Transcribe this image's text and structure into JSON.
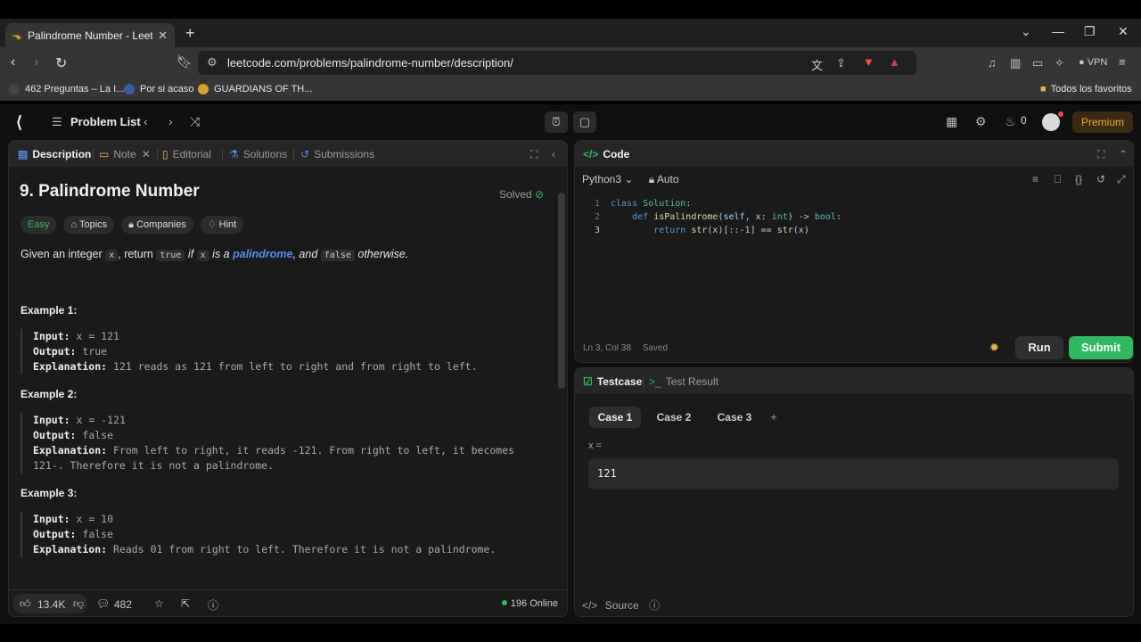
{
  "browser": {
    "tab_title": "Palindrome Number - LeetCode",
    "url": "leetcode.com/problems/palindrome-number/description/",
    "vpn_label": "VPN",
    "bookmarks": [
      {
        "label": "462 Preguntas – La I...",
        "color": "#444444"
      },
      {
        "label": "Por si acaso",
        "color": "#3d5aa8"
      },
      {
        "label": "GUARDIANS OF TH...",
        "color": "#d9a520"
      }
    ],
    "all_favorites": "Todos los favoritos"
  },
  "nav": {
    "problem_list": "Problem List",
    "streak": "0",
    "premium": "Premium"
  },
  "description_panel": {
    "tabs": [
      "Description",
      "Note",
      "Editorial",
      "Solutions",
      "Submissions"
    ],
    "title": "9. Palindrome Number",
    "solved": "Solved",
    "tags": [
      "Easy",
      "Topics",
      "Companies",
      "Hint"
    ],
    "statement": {
      "p1": "Given an integer",
      "x": "x",
      "p2": ", return",
      "true": "true",
      "p3": "if",
      "p4": "is a",
      "palindrome": "palindrome",
      "p5": ", and",
      "false": "false",
      "p6": "otherwise."
    },
    "examples": [
      {
        "title": "Example 1:",
        "input": "x = 121",
        "output": "true",
        "explanation": "121 reads as 121 from left to right and from right to left.",
        "explanation2": ""
      },
      {
        "title": "Example 2:",
        "input": "x = -121",
        "output": "false",
        "explanation": "From left to right, it reads -121. From right to left, it becomes",
        "explanation2": "121-. Therefore it is not a palindrome."
      },
      {
        "title": "Example 3:",
        "input": "x = 10",
        "output": "false",
        "explanation": "Reads 01 from right to left. Therefore it is not a palindrome.",
        "explanation2": ""
      }
    ],
    "labels": {
      "input": "Input:",
      "output": "Output:",
      "explanation": "Explanation:"
    },
    "footer": {
      "likes": "13.4K",
      "comments": "482",
      "online": "196 Online"
    }
  },
  "code_panel": {
    "title": "Code",
    "language": "Python3",
    "auto": "Auto",
    "lines": [
      "1",
      "2",
      "3"
    ],
    "status_pos": "Ln 3, Col 38",
    "status_saved": "Saved",
    "run": "Run",
    "submit": "Submit"
  },
  "testcase_panel": {
    "tabs": [
      "Testcase",
      "Test Result"
    ],
    "cases": [
      "Case 1",
      "Case 2",
      "Case 3"
    ],
    "var_label": "x =",
    "var_value": "121",
    "source": "Source"
  }
}
